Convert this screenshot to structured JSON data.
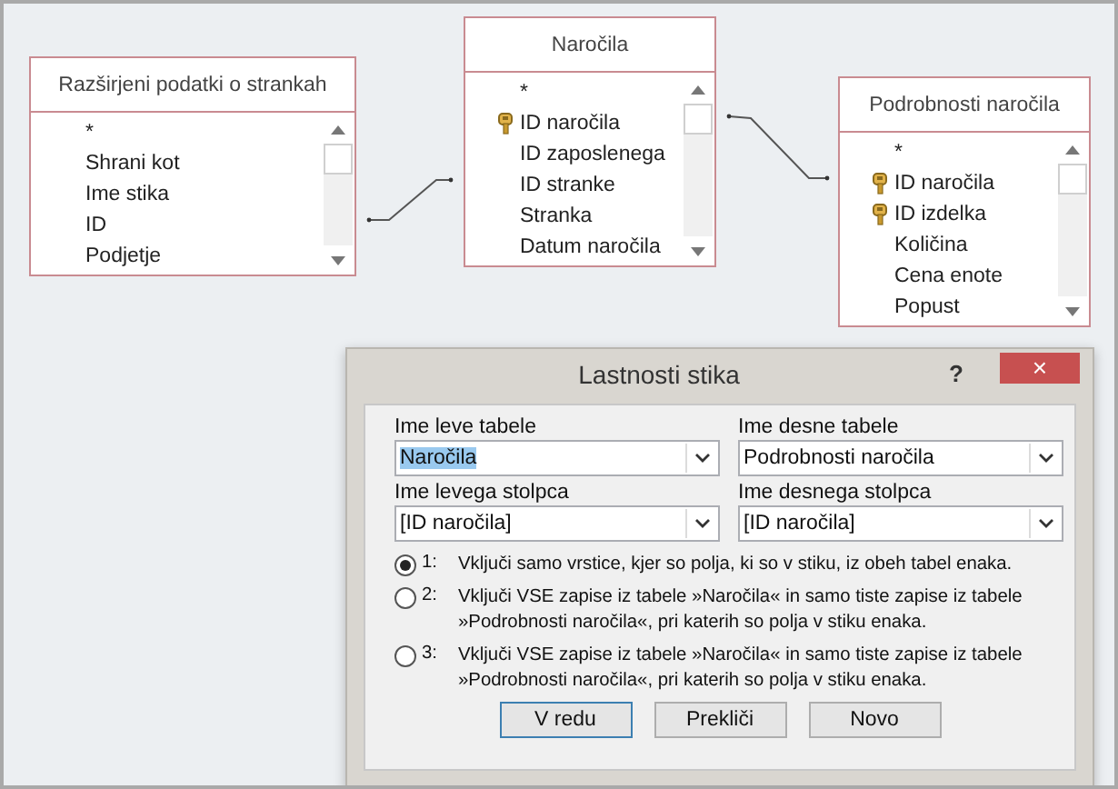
{
  "tables": [
    {
      "title": "Razširjeni podatki o strankah",
      "fields": [
        {
          "name": "*",
          "key": false
        },
        {
          "name": "Shrani kot",
          "key": false
        },
        {
          "name": "Ime stika",
          "key": false
        },
        {
          "name": "ID",
          "key": false
        },
        {
          "name": "Podjetje",
          "key": false
        }
      ]
    },
    {
      "title": "Naročila",
      "fields": [
        {
          "name": "*",
          "key": false
        },
        {
          "name": "ID naročila",
          "key": true
        },
        {
          "name": "ID zaposlenega",
          "key": false
        },
        {
          "name": "ID stranke",
          "key": false
        },
        {
          "name": "Stranka",
          "key": false
        },
        {
          "name": "Datum naročila",
          "key": false
        }
      ]
    },
    {
      "title": "Podrobnosti naročila",
      "fields": [
        {
          "name": "*",
          "key": false
        },
        {
          "name": "ID naročila",
          "key": true
        },
        {
          "name": "ID izdelka",
          "key": true
        },
        {
          "name": "Količina",
          "key": false
        },
        {
          "name": "Cena enote",
          "key": false
        },
        {
          "name": "Popust",
          "key": false
        }
      ]
    }
  ],
  "dialog": {
    "title": "Lastnosti stika",
    "help": "?",
    "close": "×",
    "fields": [
      {
        "label": "Ime leve tabele",
        "value": "Naročila",
        "highlighted": true
      },
      {
        "label": "Ime desne tabele",
        "value": "Podrobnosti naročila",
        "highlighted": false
      },
      {
        "label": "Ime levega stolpca",
        "value": "[ID naročila]",
        "highlighted": false
      },
      {
        "label": "Ime desnega stolpca",
        "value": "[ID naročila]",
        "highlighted": false
      }
    ],
    "options": [
      {
        "number": "1:",
        "text": "Vključi samo vrstice, kjer so polja, ki so v stiku, iz obeh tabel enaka.",
        "selected": true
      },
      {
        "number": "2:",
        "text": "Vključi VSE zapise iz tabele »Naročila« in samo tiste zapise iz tabele »Podrobnosti naročila«, pri katerih so polja v stiku enaka.",
        "selected": false
      },
      {
        "number": "3:",
        "text": "Vključi VSE zapise iz tabele »Naročila« in samo tiste zapise iz tabele »Podrobnosti naročila«, pri katerih so polja v stiku enaka.",
        "selected": false
      }
    ],
    "buttons": [
      {
        "label": "V redu",
        "default": true
      },
      {
        "label": "Prekliči",
        "default": false
      },
      {
        "label": "Novo",
        "default": false
      }
    ]
  }
}
